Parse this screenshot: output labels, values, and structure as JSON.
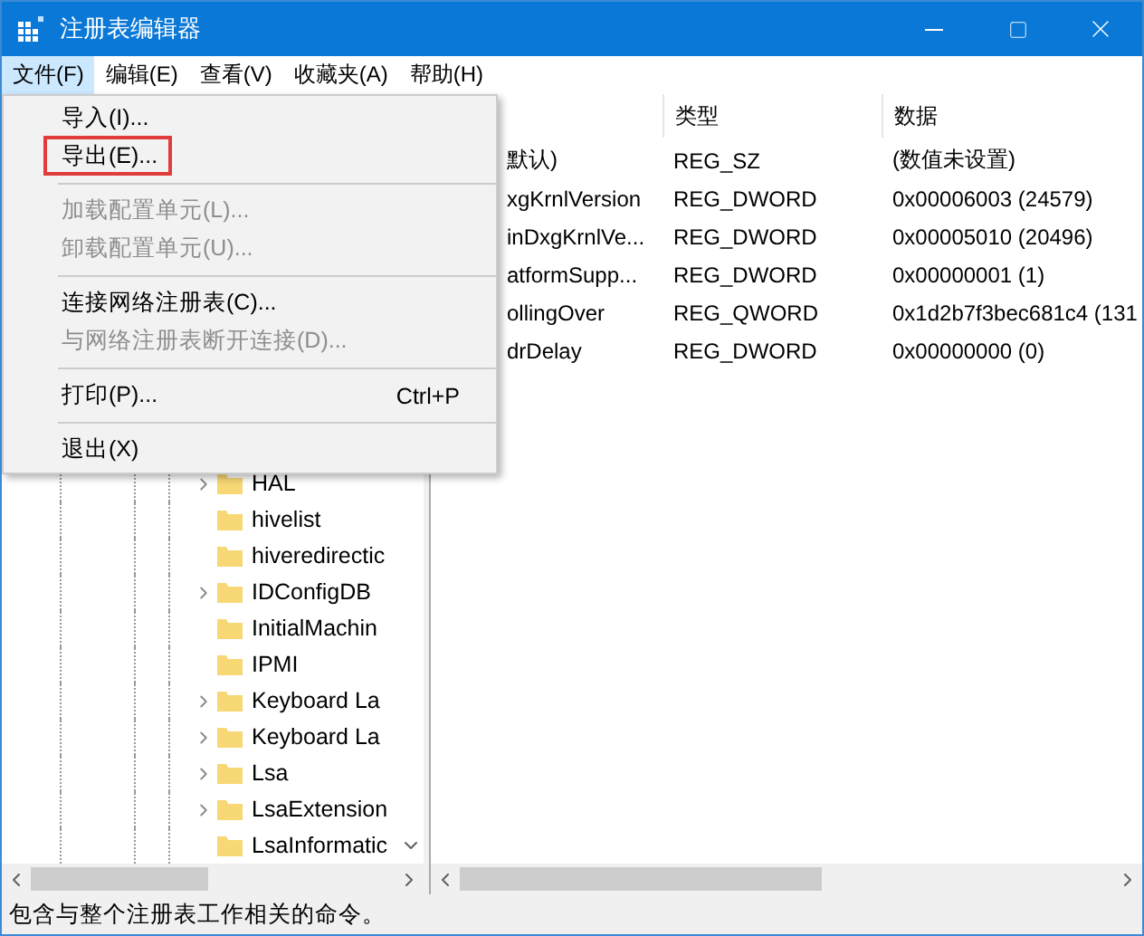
{
  "window": {
    "title": "注册表编辑器"
  },
  "menu_bar": [
    {
      "label": "文件(F)",
      "selected": true
    },
    {
      "label": "编辑(E)",
      "selected": false
    },
    {
      "label": "查看(V)",
      "selected": false
    },
    {
      "label": "收藏夹(A)",
      "selected": false
    },
    {
      "label": "帮助(H)",
      "selected": false
    }
  ],
  "file_menu": [
    {
      "kind": "item",
      "label": "导入(I)...",
      "disabled": false,
      "highlighted": false
    },
    {
      "kind": "item",
      "label": "导出(E)...",
      "disabled": false,
      "highlighted": true
    },
    {
      "kind": "separator"
    },
    {
      "kind": "item",
      "label": "加载配置单元(L)...",
      "disabled": true,
      "highlighted": false
    },
    {
      "kind": "item",
      "label": "卸载配置单元(U)...",
      "disabled": true,
      "highlighted": false
    },
    {
      "kind": "separator"
    },
    {
      "kind": "item",
      "label": "连接网络注册表(C)...",
      "disabled": false,
      "highlighted": false
    },
    {
      "kind": "item",
      "label": "与网络注册表断开连接(D)...",
      "disabled": true,
      "highlighted": false
    },
    {
      "kind": "separator"
    },
    {
      "kind": "item",
      "label": "打印(P)...",
      "shortcut": "Ctrl+P",
      "disabled": false,
      "highlighted": false
    },
    {
      "kind": "separator"
    },
    {
      "kind": "item",
      "label": "退出(X)",
      "disabled": false,
      "highlighted": false
    }
  ],
  "tree": [
    {
      "label": "HAL",
      "expandable": true
    },
    {
      "label": "hivelist",
      "expandable": false
    },
    {
      "label": "hiveredirectic",
      "expandable": false
    },
    {
      "label": "IDConfigDB",
      "expandable": true
    },
    {
      "label": "InitialMachin",
      "expandable": false
    },
    {
      "label": "IPMI",
      "expandable": false
    },
    {
      "label": "Keyboard La",
      "expandable": true
    },
    {
      "label": "Keyboard La",
      "expandable": true
    },
    {
      "label": "Lsa",
      "expandable": true
    },
    {
      "label": "LsaExtension",
      "expandable": true
    },
    {
      "label": "LsaInformatic",
      "expandable": false
    }
  ],
  "table": {
    "columns": [
      "",
      "类型",
      "数据"
    ],
    "rows": [
      [
        "默认)",
        "REG_SZ",
        "(数值未设置)"
      ],
      [
        "xgKrnlVersion",
        "REG_DWORD",
        "0x00006003 (24579)"
      ],
      [
        "inDxgKrnlVe...",
        "REG_DWORD",
        "0x00005010 (20496)"
      ],
      [
        "atformSupp...",
        "REG_DWORD",
        "0x00000001 (1)"
      ],
      [
        "ollingOver",
        "REG_QWORD",
        "0x1d2b7f3bec681c4 (131"
      ],
      [
        "drDelay",
        "REG_DWORD",
        "0x00000000 (0)"
      ]
    ]
  },
  "status_bar": "包含与整个注册表工作相关的命令。"
}
